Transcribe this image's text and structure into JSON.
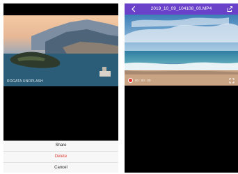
{
  "left_screen": {
    "photo_watermark": "ROGATA UNOPLASH",
    "action_sheet": {
      "share_label": "Share",
      "delete_label": "Delete",
      "cancel_label": "Cancel"
    }
  },
  "right_screen": {
    "header": {
      "title": "2019_10_09_104108_00.MP4",
      "back_icon": "chevron-left-icon",
      "share_icon": "share-icon"
    },
    "video": {
      "time": "00 : 00 : 00",
      "record_icon": "record-dot-icon",
      "fullscreen_icon": "fullscreen-icon"
    }
  },
  "colors": {
    "header_purple": "#6a42c9",
    "delete_red": "#e0443e",
    "record_red": "#e8302a"
  }
}
